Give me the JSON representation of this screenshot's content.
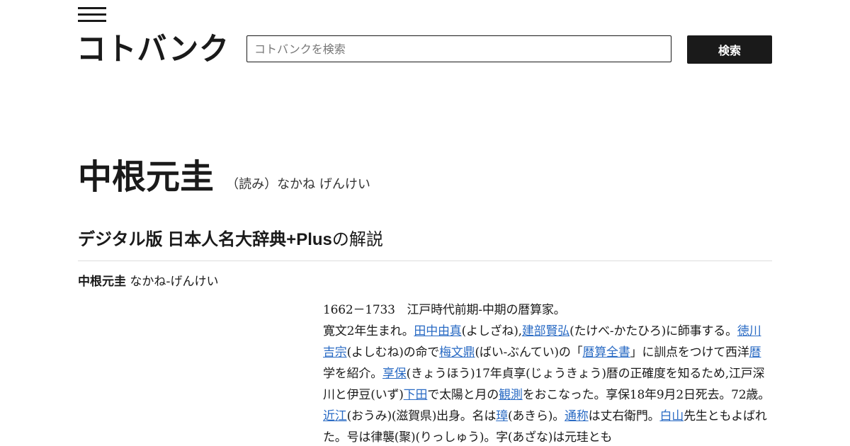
{
  "header": {
    "logo_text": "コトバンク",
    "search_placeholder": "コトバンクを検索",
    "search_button_label": "検索"
  },
  "article": {
    "title": "中根元圭",
    "reading": "（読み）なかね げんけい",
    "source_name": "デジタル版 日本人名大辞典+Plus",
    "source_suffix": "の解説",
    "entry_name": "中根元圭",
    "entry_reading": " なかね-げんけい",
    "body": [
      {
        "t": "1662－1733　江戸時代前期-中期の暦算家。"
      },
      {
        "t": "寛文2年生まれ。"
      },
      {
        "link": "田中由真"
      },
      {
        "t": "(よしざね),"
      },
      {
        "link": "建部賢弘"
      },
      {
        "t": "(たけべ-かたひろ)に師事する。"
      },
      {
        "link": "徳川吉宗"
      },
      {
        "t": "(よしむね)の命で"
      },
      {
        "link": "梅文鼎"
      },
      {
        "t": "(ばい-ぶんてい)の「"
      },
      {
        "link": "暦算全書"
      },
      {
        "t": "」に訓点をつけて西洋"
      },
      {
        "link": "暦"
      },
      {
        "t": "学を紹介。"
      },
      {
        "link": "享保"
      },
      {
        "t": "(きょうほう)17年貞享(じょうきょう)暦の正確度を知るため,江戸深川と伊豆(いず)"
      },
      {
        "link": "下田"
      },
      {
        "t": "で太陽と月の"
      },
      {
        "link": "観測"
      },
      {
        "t": "をおこなった。享保18年9月2日死去。72歳。"
      },
      {
        "link": "近江"
      },
      {
        "t": "(おうみ)(滋賀県)出身。名は"
      },
      {
        "link": "璋"
      },
      {
        "t": "(あきら)。"
      },
      {
        "link": "通称"
      },
      {
        "t": "は丈右衛門。"
      },
      {
        "link": "白山"
      },
      {
        "t": "先生ともよばれた。号は律襲(聚)(りっしゅう)。字(あざな)は元珪とも"
      }
    ]
  }
}
